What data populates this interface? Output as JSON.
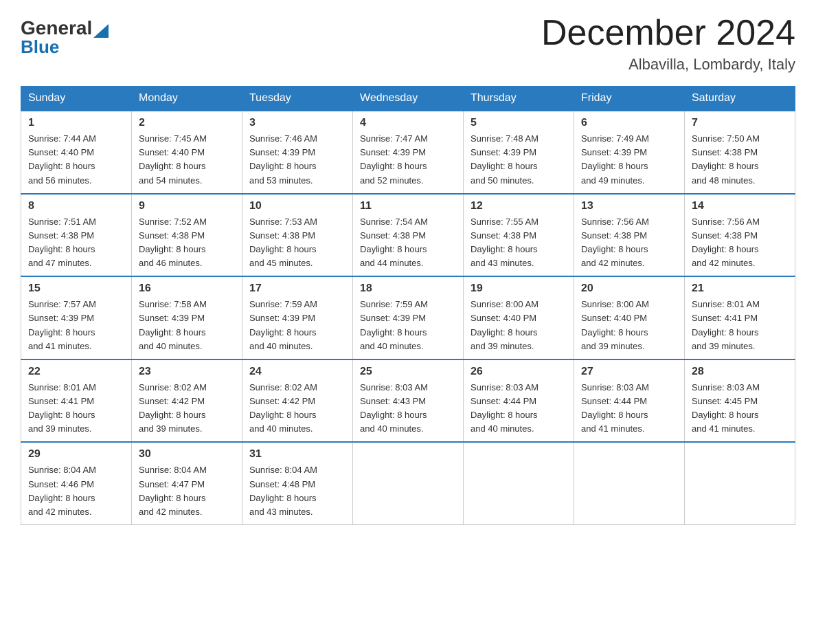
{
  "header": {
    "logo_general": "General",
    "logo_blue": "Blue",
    "title": "December 2024",
    "location": "Albavilla, Lombardy, Italy"
  },
  "days_of_week": [
    "Sunday",
    "Monday",
    "Tuesday",
    "Wednesday",
    "Thursday",
    "Friday",
    "Saturday"
  ],
  "weeks": [
    [
      {
        "day": "1",
        "sunrise": "7:44 AM",
        "sunset": "4:40 PM",
        "daylight": "8 hours and 56 minutes."
      },
      {
        "day": "2",
        "sunrise": "7:45 AM",
        "sunset": "4:40 PM",
        "daylight": "8 hours and 54 minutes."
      },
      {
        "day": "3",
        "sunrise": "7:46 AM",
        "sunset": "4:39 PM",
        "daylight": "8 hours and 53 minutes."
      },
      {
        "day": "4",
        "sunrise": "7:47 AM",
        "sunset": "4:39 PM",
        "daylight": "8 hours and 52 minutes."
      },
      {
        "day": "5",
        "sunrise": "7:48 AM",
        "sunset": "4:39 PM",
        "daylight": "8 hours and 50 minutes."
      },
      {
        "day": "6",
        "sunrise": "7:49 AM",
        "sunset": "4:39 PM",
        "daylight": "8 hours and 49 minutes."
      },
      {
        "day": "7",
        "sunrise": "7:50 AM",
        "sunset": "4:38 PM",
        "daylight": "8 hours and 48 minutes."
      }
    ],
    [
      {
        "day": "8",
        "sunrise": "7:51 AM",
        "sunset": "4:38 PM",
        "daylight": "8 hours and 47 minutes."
      },
      {
        "day": "9",
        "sunrise": "7:52 AM",
        "sunset": "4:38 PM",
        "daylight": "8 hours and 46 minutes."
      },
      {
        "day": "10",
        "sunrise": "7:53 AM",
        "sunset": "4:38 PM",
        "daylight": "8 hours and 45 minutes."
      },
      {
        "day": "11",
        "sunrise": "7:54 AM",
        "sunset": "4:38 PM",
        "daylight": "8 hours and 44 minutes."
      },
      {
        "day": "12",
        "sunrise": "7:55 AM",
        "sunset": "4:38 PM",
        "daylight": "8 hours and 43 minutes."
      },
      {
        "day": "13",
        "sunrise": "7:56 AM",
        "sunset": "4:38 PM",
        "daylight": "8 hours and 42 minutes."
      },
      {
        "day": "14",
        "sunrise": "7:56 AM",
        "sunset": "4:38 PM",
        "daylight": "8 hours and 42 minutes."
      }
    ],
    [
      {
        "day": "15",
        "sunrise": "7:57 AM",
        "sunset": "4:39 PM",
        "daylight": "8 hours and 41 minutes."
      },
      {
        "day": "16",
        "sunrise": "7:58 AM",
        "sunset": "4:39 PM",
        "daylight": "8 hours and 40 minutes."
      },
      {
        "day": "17",
        "sunrise": "7:59 AM",
        "sunset": "4:39 PM",
        "daylight": "8 hours and 40 minutes."
      },
      {
        "day": "18",
        "sunrise": "7:59 AM",
        "sunset": "4:39 PM",
        "daylight": "8 hours and 40 minutes."
      },
      {
        "day": "19",
        "sunrise": "8:00 AM",
        "sunset": "4:40 PM",
        "daylight": "8 hours and 39 minutes."
      },
      {
        "day": "20",
        "sunrise": "8:00 AM",
        "sunset": "4:40 PM",
        "daylight": "8 hours and 39 minutes."
      },
      {
        "day": "21",
        "sunrise": "8:01 AM",
        "sunset": "4:41 PM",
        "daylight": "8 hours and 39 minutes."
      }
    ],
    [
      {
        "day": "22",
        "sunrise": "8:01 AM",
        "sunset": "4:41 PM",
        "daylight": "8 hours and 39 minutes."
      },
      {
        "day": "23",
        "sunrise": "8:02 AM",
        "sunset": "4:42 PM",
        "daylight": "8 hours and 39 minutes."
      },
      {
        "day": "24",
        "sunrise": "8:02 AM",
        "sunset": "4:42 PM",
        "daylight": "8 hours and 40 minutes."
      },
      {
        "day": "25",
        "sunrise": "8:03 AM",
        "sunset": "4:43 PM",
        "daylight": "8 hours and 40 minutes."
      },
      {
        "day": "26",
        "sunrise": "8:03 AM",
        "sunset": "4:44 PM",
        "daylight": "8 hours and 40 minutes."
      },
      {
        "day": "27",
        "sunrise": "8:03 AM",
        "sunset": "4:44 PM",
        "daylight": "8 hours and 41 minutes."
      },
      {
        "day": "28",
        "sunrise": "8:03 AM",
        "sunset": "4:45 PM",
        "daylight": "8 hours and 41 minutes."
      }
    ],
    [
      {
        "day": "29",
        "sunrise": "8:04 AM",
        "sunset": "4:46 PM",
        "daylight": "8 hours and 42 minutes."
      },
      {
        "day": "30",
        "sunrise": "8:04 AM",
        "sunset": "4:47 PM",
        "daylight": "8 hours and 42 minutes."
      },
      {
        "day": "31",
        "sunrise": "8:04 AM",
        "sunset": "4:48 PM",
        "daylight": "8 hours and 43 minutes."
      },
      null,
      null,
      null,
      null
    ]
  ],
  "labels": {
    "sunrise": "Sunrise:",
    "sunset": "Sunset:",
    "daylight": "Daylight:"
  }
}
